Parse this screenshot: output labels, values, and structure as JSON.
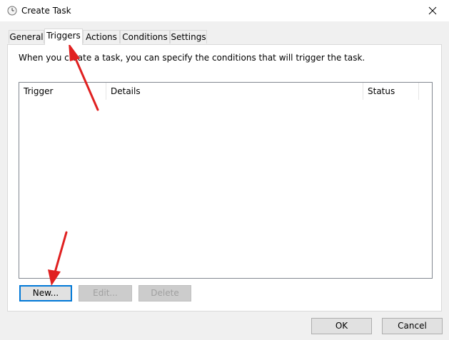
{
  "window": {
    "title": "Create Task",
    "icon": "clock-icon",
    "close_icon": "close-icon"
  },
  "tabs": [
    {
      "label": "General",
      "active": false
    },
    {
      "label": "Triggers",
      "active": true
    },
    {
      "label": "Actions",
      "active": false
    },
    {
      "label": "Conditions",
      "active": false
    },
    {
      "label": "Settings",
      "active": false
    }
  ],
  "triggers": {
    "description": "When you create a task, you can specify the conditions that will trigger the task.",
    "columns": [
      "Trigger",
      "Details",
      "Status"
    ],
    "rows": [],
    "buttons": {
      "new": "New...",
      "edit": "Edit...",
      "delete": "Delete"
    }
  },
  "footer": {
    "ok": "OK",
    "cancel": "Cancel"
  },
  "colors": {
    "annotation_arrow": "#e02020",
    "focus": "#0078d7"
  }
}
